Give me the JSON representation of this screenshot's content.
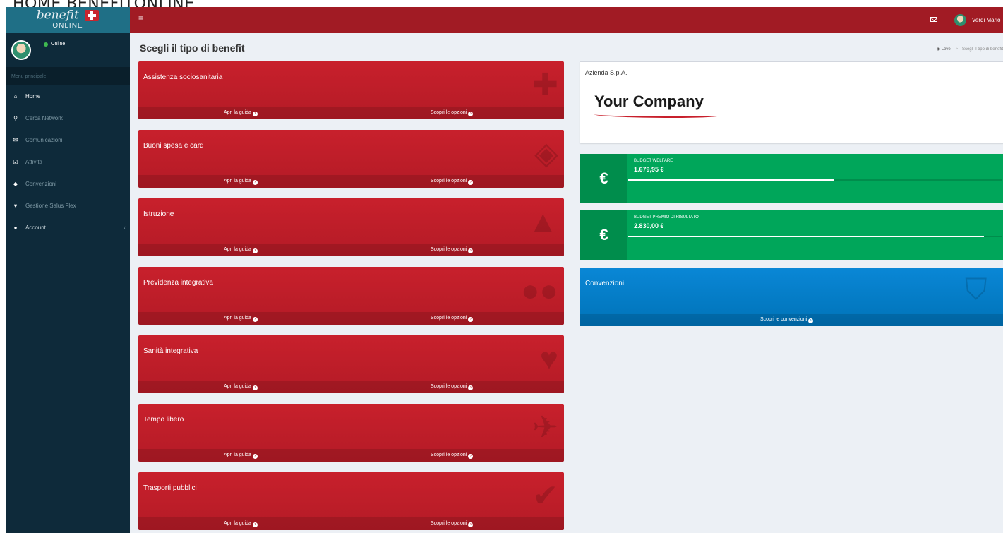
{
  "page_label": "HOME BENEFITONLINE",
  "sidebar": {
    "logo_main": "benefit",
    "logo_sub": "ONLINE",
    "status": "Online",
    "menu_header": "Menu principale",
    "items": [
      {
        "label": "Home",
        "icon": "home-icon",
        "glyph": "⌂"
      },
      {
        "label": "Cerca Network",
        "icon": "map-marker-icon",
        "glyph": "⚲"
      },
      {
        "label": "Comunicazioni",
        "icon": "envelope-icon",
        "glyph": "✉"
      },
      {
        "label": "Attività",
        "icon": "check-square-icon",
        "glyph": "☑"
      },
      {
        "label": "Convenzioni",
        "icon": "tags-icon",
        "glyph": "◆"
      },
      {
        "label": "Gestione Salus Flex",
        "icon": "heartbeat-icon",
        "glyph": "♥"
      },
      {
        "label": "Account",
        "icon": "user-icon",
        "glyph": "●",
        "chevron": "‹"
      }
    ]
  },
  "topbar": {
    "menu_glyph": "≡",
    "user_name": "Verdi Mario"
  },
  "content": {
    "title": "Scegli il tipo di benefit",
    "breadcrumb": {
      "root": "Level",
      "separator": ">",
      "current": "Scegli il tipo di benefit"
    }
  },
  "benefit_cards": [
    {
      "title": "Assistenza sociosanitaria",
      "icon": "medkit-icon",
      "glyph": "✚",
      "guide": "Apri la guida",
      "options": "Scopri le opzioni"
    },
    {
      "title": "Buoni spesa e card",
      "icon": "tag-icon",
      "glyph": "◈",
      "guide": "Apri la guida",
      "options": "Scopri le opzioni"
    },
    {
      "title": "Istruzione",
      "icon": "graduation-cap-icon",
      "glyph": "▲",
      "guide": "Apri la guida",
      "options": "Scopri le opzioni"
    },
    {
      "title": "Previdenza integrativa",
      "icon": "users-icon",
      "glyph": "●●",
      "guide": "Apri la guida",
      "options": "Scopri le opzioni"
    },
    {
      "title": "Sanità integrativa",
      "icon": "heart-icon",
      "glyph": "♥",
      "guide": "Apri la guida",
      "options": "Scopri le opzioni"
    },
    {
      "title": "Tempo libero",
      "icon": "plane-icon",
      "glyph": "✈",
      "guide": "Apri la guida",
      "options": "Scopri le opzioni"
    },
    {
      "title": "Trasporti pubblici",
      "icon": "check-circle-icon",
      "glyph": "✔",
      "guide": "Apri la guida",
      "options": "Scopri le opzioni"
    }
  ],
  "company": {
    "name": "Azienda S.p.A.",
    "logo_text": "Your Company"
  },
  "budgets": [
    {
      "label": "BUDGET WELFARE",
      "value": "1.679,95 €",
      "currency_glyph": "€",
      "progress_pct": 55
    },
    {
      "label": "BUDGET PREMIO DI RISULTATO",
      "value": "2.830,00 €",
      "currency_glyph": "€",
      "progress_pct": 95
    }
  ],
  "convenzioni_card": {
    "title": "Convenzioni",
    "icon": "shopping-bag-icon",
    "glyph": "⛉",
    "link": "Scopri le convenzioni"
  },
  "colors": {
    "topbar": "#a11b24",
    "card_red": "#c8202c",
    "budget_green": "#00a65a",
    "conv_blue": "#0a87d6",
    "sidebar": "#0e2a3a"
  }
}
